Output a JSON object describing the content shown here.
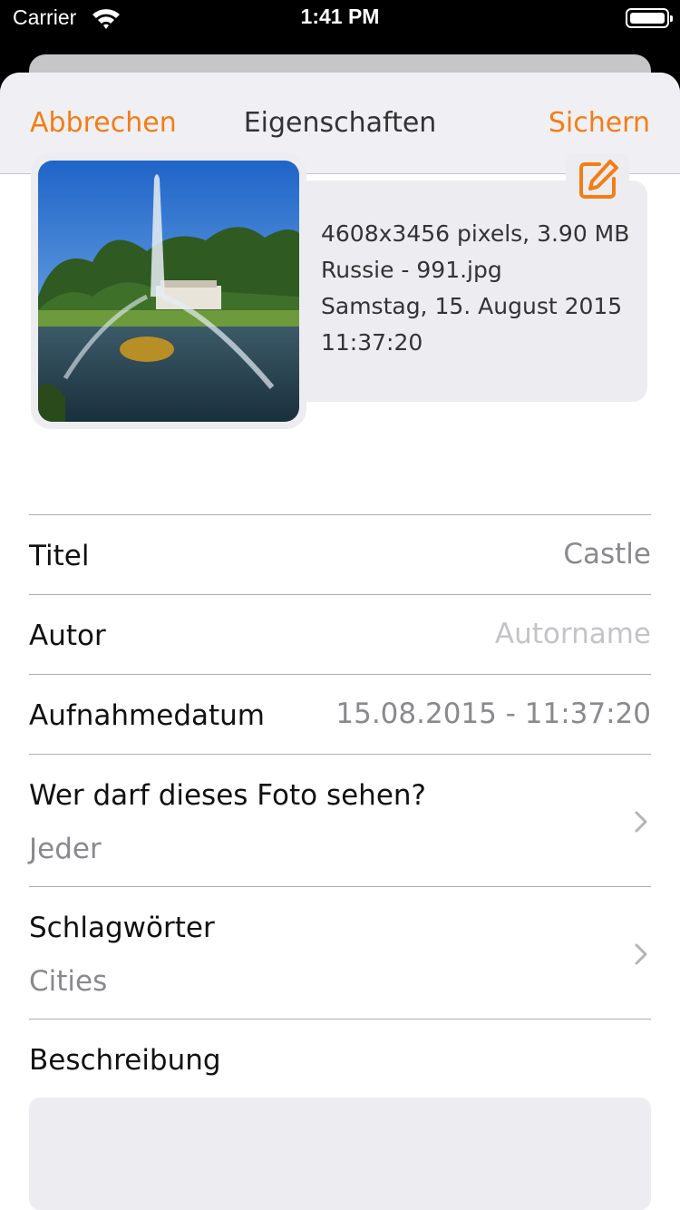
{
  "status_bar": {
    "carrier": "Carrier",
    "time": "1:41 PM",
    "icons": [
      "wifi-icon",
      "battery-icon"
    ]
  },
  "nav": {
    "cancel_label": "Abbrechen",
    "title": "Eigenschaften",
    "save_label": "Sichern"
  },
  "photo": {
    "dimensions_size": "4608x3456 pixels, 3.90 MB",
    "filename": "Russie - 991.jpg",
    "date": "Samstag, 15. August 2015",
    "time": "11:37:20",
    "edit_icon": "edit-icon"
  },
  "fields": {
    "title_label": "Titel",
    "title_value": "Castle",
    "author_label": "Autor",
    "author_placeholder": "Autorname",
    "date_label": "Aufnahmedatum",
    "date_value": "15.08.2015 - 11:37:20",
    "visibility_label": "Wer darf dieses Foto sehen?",
    "visibility_value": "Jeder",
    "tags_label": "Schlagwörter",
    "tags_value": "Cities",
    "description_label": "Beschreibung",
    "description_value": ""
  },
  "colors": {
    "accent": "#f47d14",
    "sheet_background": "#ffffff",
    "nav_background": "#f0f0f4",
    "card_background": "#ededf1",
    "secondary_text": "#8a8a8e",
    "placeholder_text": "#c4c4c8"
  }
}
